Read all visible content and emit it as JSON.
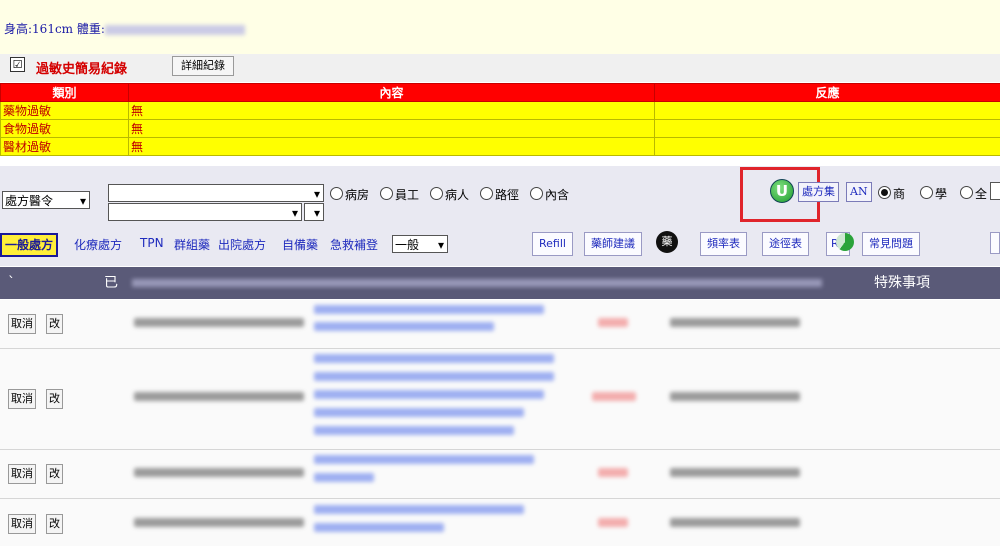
{
  "patient": {
    "height_label": "身高:161cm",
    "weight_label": "體重:"
  },
  "allergy": {
    "title": "過敏史簡易紀錄",
    "checkbox_mark": "☑",
    "detail_button": "詳細紀錄",
    "headers": [
      "類別",
      "內容",
      "反應"
    ],
    "rows": [
      {
        "category": "藥物過敏",
        "content": "無",
        "reaction": ""
      },
      {
        "category": "食物過敏",
        "content": "無",
        "reaction": ""
      },
      {
        "category": "醫材過敏",
        "content": "無",
        "reaction": ""
      }
    ]
  },
  "controls": {
    "order_type_select": "處方醫令",
    "radios": [
      {
        "label": "病房",
        "checked": false
      },
      {
        "label": "員工",
        "checked": false
      },
      {
        "label": "病人",
        "checked": false
      },
      {
        "label": "路徑",
        "checked": false
      },
      {
        "label": "內含",
        "checked": false
      }
    ],
    "u_icon_label": "U",
    "prescription_set_button": "處方集",
    "an_button": "AN",
    "right_radios": [
      {
        "label": "商",
        "checked": true
      },
      {
        "label": "學",
        "checked": false
      },
      {
        "label": "全",
        "checked": false
      }
    ]
  },
  "tabs": {
    "general": "一般處方",
    "links": [
      "化療處方",
      "TPN",
      "群組藥",
      "出院處方",
      "自備藥",
      "急救補登"
    ],
    "category_select": "一般",
    "tools": [
      "Refill",
      "藥師建議",
      "頻率表",
      "途徑表",
      "Rx",
      "常見問題"
    ],
    "drug_icon_label": "藥"
  },
  "grid": {
    "headers": {
      "done": "已",
      "special": "特殊事項"
    },
    "row_buttons": {
      "cancel": "取消",
      "edit": "改"
    }
  }
}
